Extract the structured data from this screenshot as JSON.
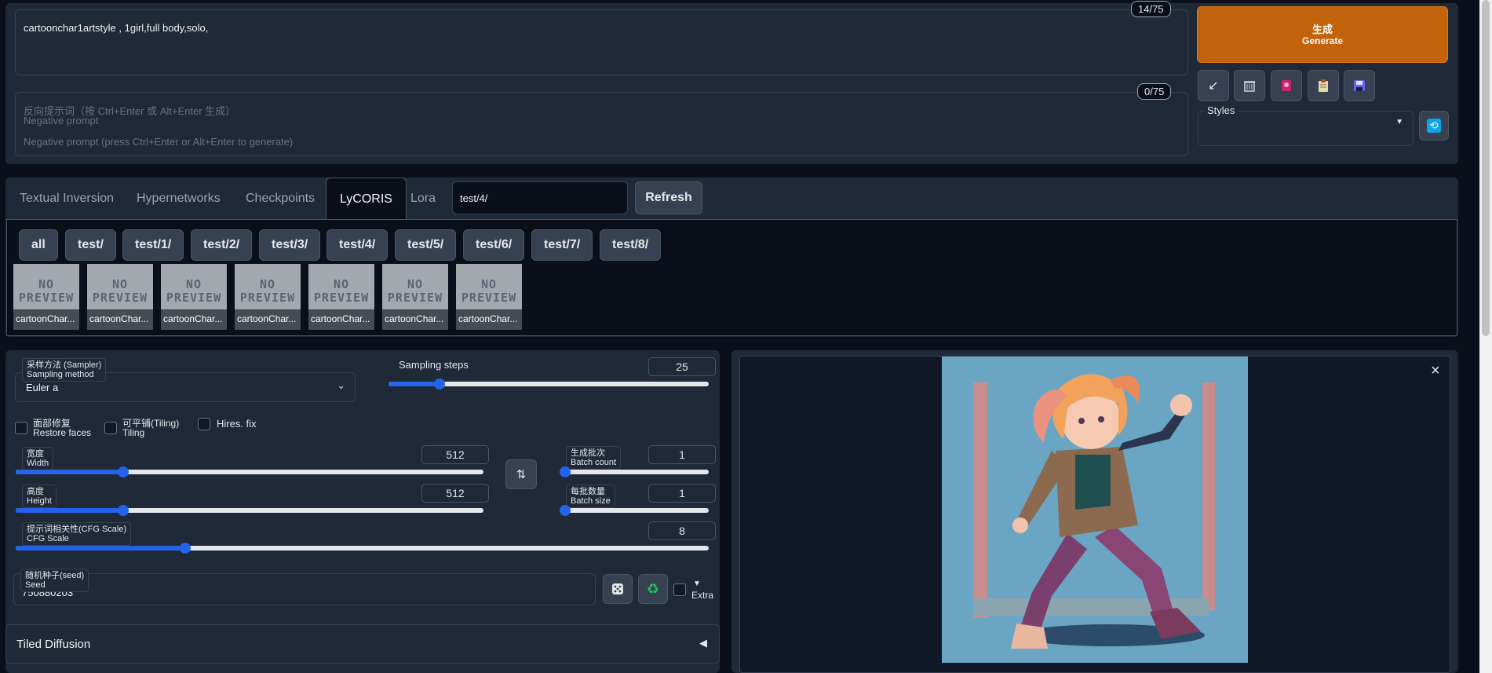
{
  "prompt": {
    "value": "cartoonchar1artstyle , 1girl,full body,solo,",
    "counter": "14/75"
  },
  "negative_prompt": {
    "placeholder_cn": "反向提示词（按 Ctrl+Enter 或 Alt+Enter 生成）",
    "placeholder_en1": "Negative prompt",
    "placeholder_en2": "Negative prompt (press Ctrl+Enter or Alt+Enter to generate)",
    "counter": "0/75"
  },
  "generate": {
    "label_cn": "生成",
    "label_en": "Generate",
    "color": "#c2620a"
  },
  "tool_icons": [
    "arrow-icon",
    "trash-icon",
    "model-icon",
    "clipboard-icon",
    "save-icon"
  ],
  "styles": {
    "label": "Styles",
    "refresh_icon": "refresh-icon"
  },
  "network_tabs": {
    "tabs": [
      "Textual Inversion",
      "Hypernetworks",
      "Checkpoints",
      "LyCORIS",
      "Lora"
    ],
    "active": "LyCORIS",
    "search_value": "test/4/",
    "refresh_label": "Refresh"
  },
  "folders": [
    "all",
    "test/",
    "test/1/",
    "test/2/",
    "test/3/",
    "test/4/",
    "test/5/",
    "test/6/",
    "test/7/",
    "test/8/"
  ],
  "cards": {
    "preview_text": "NO PREVIEW",
    "names": [
      "cartoonChar...",
      "cartoonChar...",
      "cartoonChar...",
      "cartoonChar...",
      "cartoonChar...",
      "cartoonChar...",
      "cartoonChar..."
    ]
  },
  "settings": {
    "sampler": {
      "label_cn": "采样方法 (Sampler)",
      "label_en": "Sampling method",
      "value": "Euler a"
    },
    "steps": {
      "label": "Sampling steps",
      "value": "25",
      "fraction": 0.16
    },
    "restore_faces": {
      "cn": "面部修复",
      "en": "Restore faces"
    },
    "tiling": {
      "cn": "可平铺(Tiling)",
      "en": "Tiling"
    },
    "hires": {
      "label": "Hires. fix"
    },
    "width": {
      "cn": "宽度",
      "en": "Width",
      "value": "512",
      "fraction": 0.23
    },
    "height": {
      "cn": "高度",
      "en": "Height",
      "value": "512",
      "fraction": 0.23
    },
    "batch_count": {
      "cn": "生成批次",
      "en": "Batch count",
      "value": "1",
      "fraction": 0.0
    },
    "batch_size": {
      "cn": "每批数量",
      "en": "Batch size",
      "value": "1",
      "fraction": 0.0
    },
    "cfg": {
      "cn": "提示词相关性(CFG Scale)",
      "en": "CFG Scale",
      "value": "8",
      "fraction": 0.245
    },
    "seed": {
      "cn": "随机种子(seed)",
      "en": "Seed",
      "value": "750880203"
    },
    "extra": {
      "label": "Extra",
      "arrow": "▼"
    },
    "tiled_diffusion": {
      "label": "Tiled Diffusion",
      "arrow": "◀"
    }
  },
  "output": {
    "close_icon": "×"
  }
}
